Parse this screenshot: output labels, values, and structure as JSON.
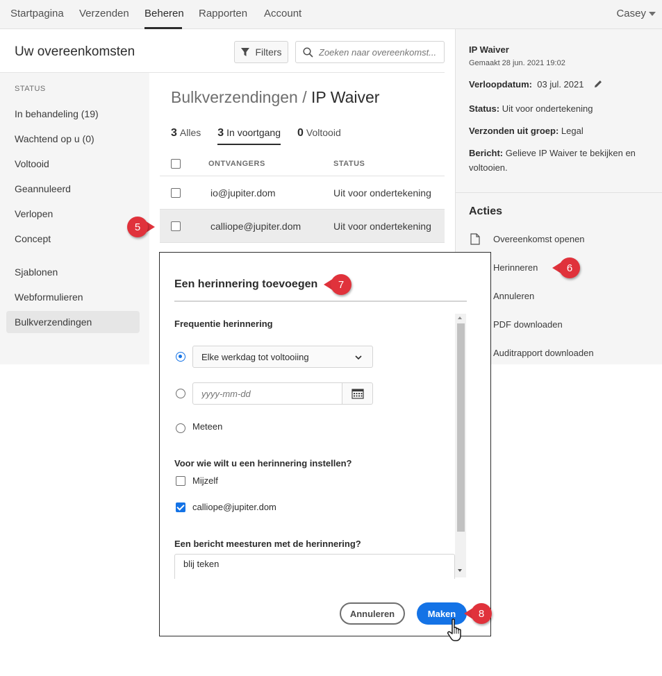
{
  "topnav": {
    "items": [
      "Startpagina",
      "Verzenden",
      "Beheren",
      "Rapporten",
      "Account"
    ],
    "user": "Casey"
  },
  "header": {
    "title": "Uw overeenkomsten",
    "filters_label": "Filters",
    "search_placeholder": "Zoeken naar overeenkomst..."
  },
  "sidebar": {
    "section_label": "STATUS",
    "items": [
      "In behandeling (19)",
      "Wachtend op u (0)",
      "Voltooid",
      "Geannuleerd",
      "Verlopen",
      "Concept",
      "Sjablonen",
      "Webformulieren",
      "Bulkverzendingen"
    ],
    "selected": "Bulkverzendingen"
  },
  "main": {
    "breadcrumb_prefix": "Bulkverzendingen / ",
    "breadcrumb_current": "IP Waiver",
    "tabs": [
      {
        "count": "3",
        "label": "Alles"
      },
      {
        "count": "3",
        "label": "In voortgang"
      },
      {
        "count": "0",
        "label": "Voltooid"
      }
    ],
    "columns": [
      "ONTVANGERS",
      "STATUS"
    ],
    "rows": [
      {
        "email": "io@jupiter.dom",
        "status": "Uit voor ondertekening"
      },
      {
        "email": "calliope@jupiter.dom",
        "status": "Uit voor ondertekening"
      }
    ]
  },
  "details": {
    "title": "IP Waiver",
    "created": "Gemaakt 28 jun. 2021 19:02",
    "expiry_label": "Verloopdatum:",
    "expiry_value": "03 jul. 2021",
    "status_label": "Status:",
    "status_value": "Uit voor ondertekening",
    "group_label": "Verzonden uit groep:",
    "group_value": "Legal",
    "message_label": "Bericht:",
    "message_line1": "Gelieve IP Waiver te bekijken en",
    "message_line2": "voltooien.",
    "actions_title": "Acties",
    "actions": [
      "Overeenkomst openen",
      "Herinneren",
      "Annuleren",
      "PDF downloaden",
      "Auditrapport downloaden"
    ]
  },
  "modal": {
    "title": "Een herinnering toevoegen",
    "frequency_label": "Frequentie herinnering",
    "frequency_option": "Elke werkdag tot voltooiing",
    "date_placeholder": "yyyy-mm-dd",
    "now_option": "Meteen",
    "who_label": "Voor wie wilt u een herinnering instellen?",
    "self_option": "Mijzelf",
    "recipient_option": "calliope@jupiter.dom",
    "message_label": "Een bericht meesturen met de herinnering?",
    "message_value": "blij teken",
    "cancel_label": "Annuleren",
    "make_label": "Maken"
  },
  "callouts": [
    "5",
    "6",
    "7",
    "8"
  ],
  "colors": {
    "accent": "#1473e6",
    "callout": "#e0323b"
  }
}
